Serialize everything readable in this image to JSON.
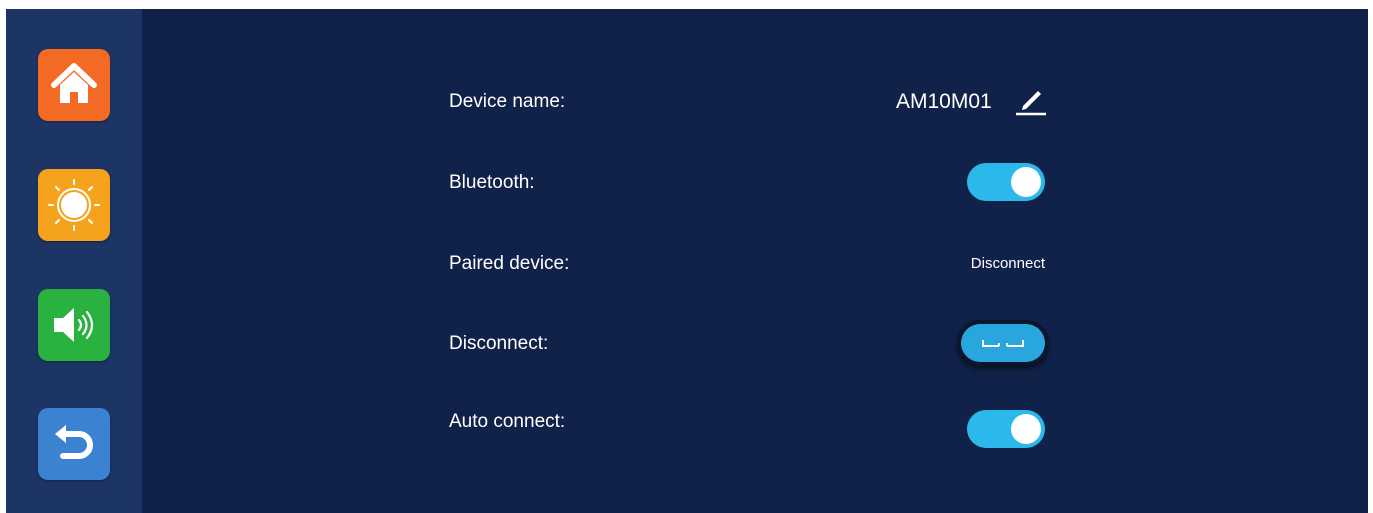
{
  "colors": {
    "screen_background": "#11224a",
    "sidebar_background": "#1d3564",
    "home_button": "#f26a23",
    "brightness_button": "#f5a31d",
    "volume_button": "#2ab240",
    "back_button": "#3b82d1",
    "toggle_on": "#2bb9ec"
  },
  "sidebar": {
    "items": [
      {
        "name": "home",
        "icon": "home-icon"
      },
      {
        "name": "brightness",
        "icon": "sun-icon"
      },
      {
        "name": "volume",
        "icon": "speaker-icon"
      },
      {
        "name": "back",
        "icon": "return-arrow-icon"
      }
    ]
  },
  "settings": {
    "device_name": {
      "label": "Device name:",
      "value": "AM10M01",
      "edit_icon": "pencil-icon"
    },
    "bluetooth": {
      "label": "Bluetooth:",
      "enabled": true
    },
    "paired_device": {
      "label": "Paired device:",
      "value": "Disconnect"
    },
    "disconnect": {
      "label": "Disconnect:",
      "button_icon": "unlink-icon"
    },
    "auto_connect": {
      "label": "Auto connect:",
      "enabled": true
    }
  }
}
